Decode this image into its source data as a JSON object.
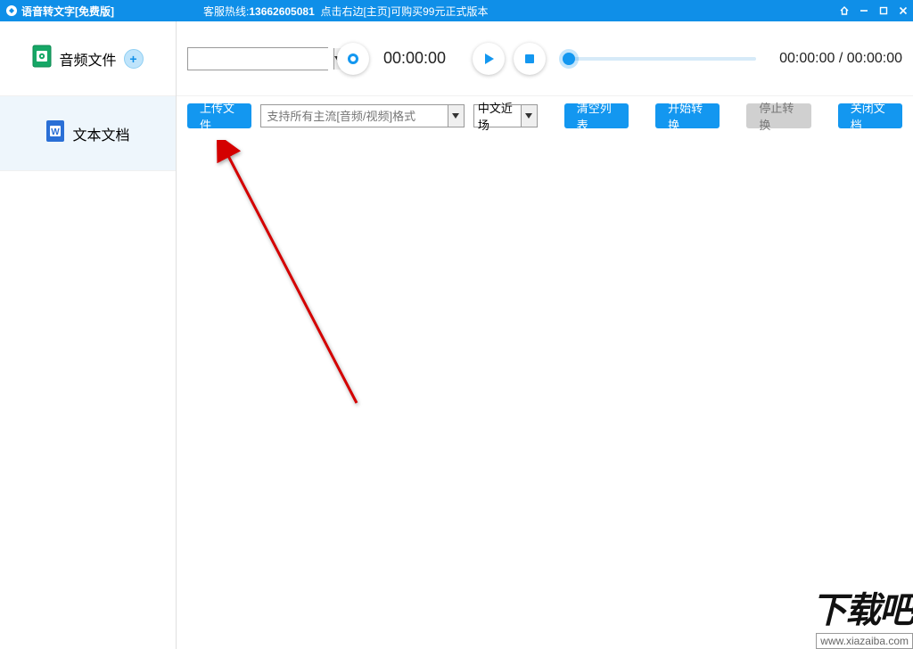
{
  "titlebar": {
    "app_title": "语音转文字[免费版]",
    "hotline_label": "客服热线:",
    "hotline_number": "13662605081",
    "hotline_tip": "点击右边[主页]可购买99元正式版本"
  },
  "sidebar": {
    "item_audio": "音频文件",
    "item_text": "文本文档"
  },
  "player": {
    "rec_time": "00:00:00",
    "pos_time": "00:00:00",
    "dur_time": "00:00:00",
    "time_sep": " / "
  },
  "toolbar": {
    "upload": "上传文件",
    "format_placeholder": "支持所有主流[音频/视频]格式",
    "lang_selected": "中文近场",
    "clear": "清空列表",
    "start": "开始转换",
    "stop": "停止转换",
    "close": "关闭文档"
  },
  "watermark": {
    "cn": "下载吧",
    "url": "www.xiazaiba.com"
  }
}
